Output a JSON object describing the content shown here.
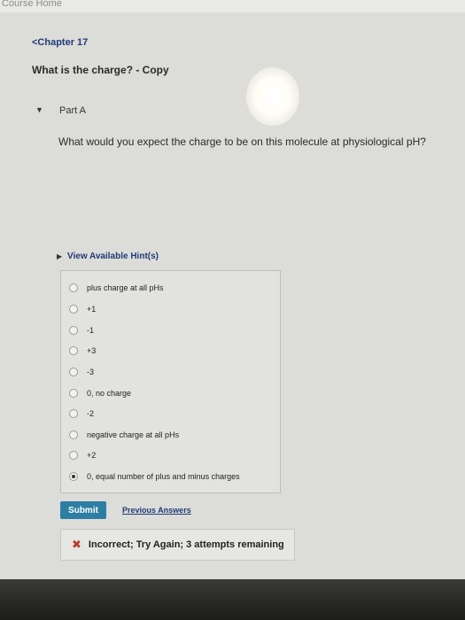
{
  "header": {
    "course_home": "Course Home",
    "chapter": "<Chapter 17",
    "title": "What is the charge? - Copy"
  },
  "part": {
    "toggle_icon": "▼",
    "label": "Part A"
  },
  "question": "What would you expect the charge to be on this molecule at physiological pH?",
  "hints": {
    "arrow_icon": "▶",
    "label": "View Available Hint(s)"
  },
  "options": [
    {
      "label": "plus charge at all pHs",
      "selected": false
    },
    {
      "label": "+1",
      "selected": false
    },
    {
      "label": "-1",
      "selected": false
    },
    {
      "label": "+3",
      "selected": false
    },
    {
      "label": "-3",
      "selected": false
    },
    {
      "label": "0, no charge",
      "selected": false
    },
    {
      "label": "-2",
      "selected": false
    },
    {
      "label": "negative charge at all pHs",
      "selected": false
    },
    {
      "label": "+2",
      "selected": false
    },
    {
      "label": "0, equal number of plus and minus charges",
      "selected": true
    }
  ],
  "actions": {
    "submit_label": "Submit",
    "previous_answers_label": "Previous Answers"
  },
  "feedback": {
    "icon": "✖",
    "text": "Incorrect; Try Again; 3 attempts remaining"
  },
  "colors": {
    "link": "#1f3b78",
    "submit_bg": "#2c7fa3",
    "error": "#c0392b"
  }
}
